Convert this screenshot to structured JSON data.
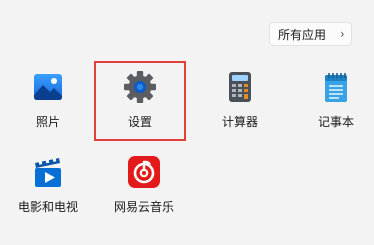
{
  "header": {
    "all_apps_label": "所有应用",
    "chevron_glyph": "›"
  },
  "apps": [
    {
      "label": "照片",
      "icon": "photos-icon"
    },
    {
      "label": "设置",
      "icon": "settings-gear-icon",
      "highlighted": true
    },
    {
      "label": "计算器",
      "icon": "calculator-icon"
    },
    {
      "label": "记事本",
      "icon": "notepad-icon"
    },
    {
      "label": "电影和电视",
      "icon": "movies-tv-icon"
    },
    {
      "label": "网易云音乐",
      "icon": "netease-music-icon"
    }
  ],
  "colors": {
    "highlight": "#e0403a",
    "music_red": "#e21a1a",
    "movies_blue": "#0a6fd4"
  }
}
